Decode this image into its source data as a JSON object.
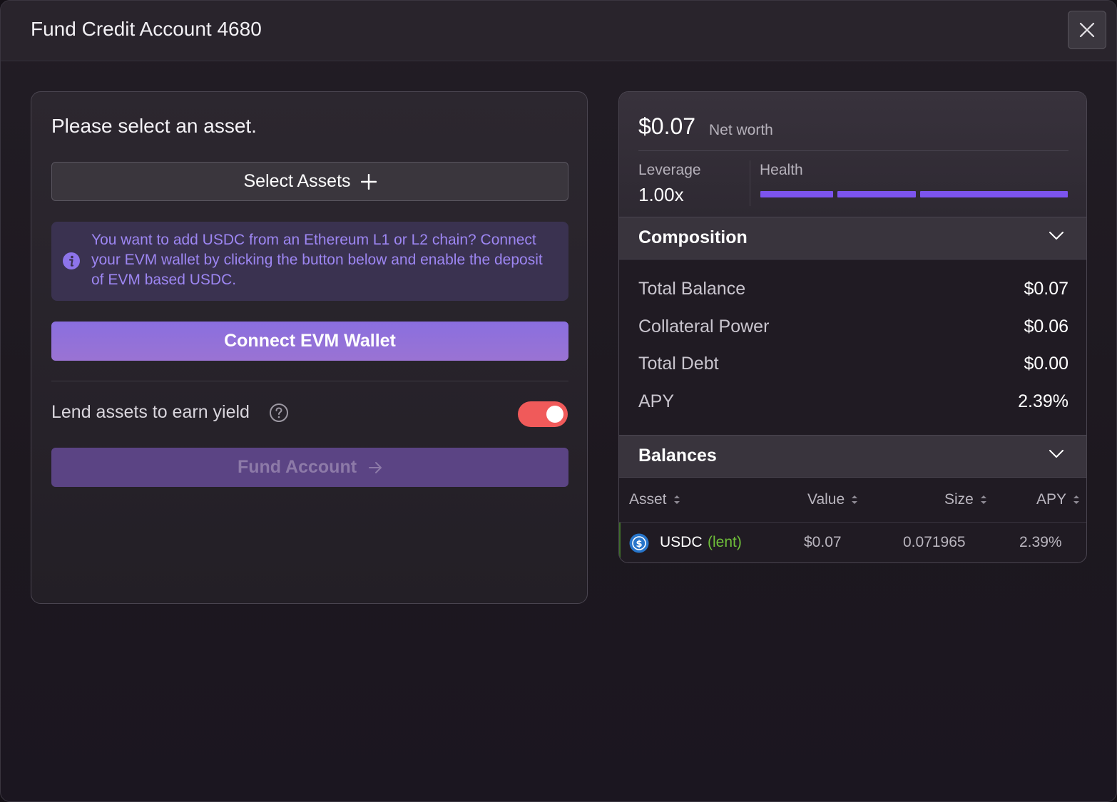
{
  "modal": {
    "title": "Fund Credit Account 4680"
  },
  "left": {
    "prompt": "Please select an asset.",
    "select_assets_label": "Select Assets",
    "info_text": "You want to add USDC from an Ethereum L1 or L2 chain? Connect your EVM wallet by clicking the button below and enable the deposit of EVM based USDC.",
    "connect_label": "Connect EVM Wallet",
    "lend_label": "Lend assets to earn yield",
    "lend_enabled": true,
    "fund_label": "Fund Account"
  },
  "summary": {
    "net_worth_value": "$0.07",
    "net_worth_label": "Net worth",
    "leverage_label": "Leverage",
    "leverage_value": "1.00x",
    "health_label": "Health",
    "health_fraction": 1.0
  },
  "composition": {
    "title": "Composition",
    "rows": [
      {
        "label": "Total Balance",
        "value": "$0.07"
      },
      {
        "label": "Collateral Power",
        "value": "$0.06"
      },
      {
        "label": "Total Debt",
        "value": "$0.00"
      },
      {
        "label": "APY",
        "value": "2.39%"
      }
    ]
  },
  "balances": {
    "title": "Balances",
    "columns": [
      "Asset",
      "Value",
      "Size",
      "APY"
    ],
    "rows": [
      {
        "asset": "USDC",
        "tag": "(lent)",
        "value": "$0.07",
        "size": "0.071965",
        "apy": "2.39%"
      }
    ]
  },
  "colors": {
    "accent": "#8a6fdf",
    "health": "#7c54ef",
    "toggle_on": "#f05a5a",
    "info_text": "#9d86f2",
    "lent_tag": "#6fbf3a",
    "usdc_blue": "#2775ca"
  },
  "icons": {
    "close": "close-icon",
    "plus": "plus-icon",
    "info": "info-icon",
    "help": "help-circle-icon",
    "arrow": "arrow-right-icon",
    "chevron": "chevron-down-icon",
    "sort": "sort-icon",
    "usdc": "usdc-icon"
  }
}
